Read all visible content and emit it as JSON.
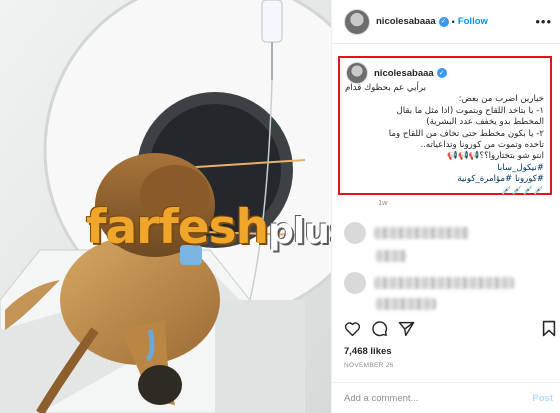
{
  "photo": {
    "description_icon": "lion-ct-scan-photo",
    "watermark": {
      "main": "farfesh",
      "sub": "plus.com"
    }
  },
  "post": {
    "username": "nicolesabaaa",
    "verified_icon": "verified-badge-icon",
    "separator": "•",
    "follow_label": "Follow",
    "more_icon": "more-options-icon",
    "caption_lines": [
      "برأيي عم بحظوك قدام",
      "خيارين اضرب من بعض:",
      "١- يا بتاخد اللقاح وبتموت (اذا مثل ما بقال",
      "المخطط بدو يخفف عدد البشرية)",
      "٢- يا بكون مخطط حتى تخاف من اللقاح وما",
      "تاخده وتموت من كورونا وتداعياته..",
      "انتو شو بتختاروا؟؟📢📢📢",
      "#نيكول_سابا",
      "#كورونا #مؤامرة_كونية",
      "💉💉💉💉"
    ],
    "caption_time": "1w",
    "like_count": "7,468 likes",
    "date": "NOVEMBER 26",
    "comment_placeholder": "Add a comment...",
    "post_label": "Post",
    "icons": {
      "like": "heart-icon",
      "comment": "comment-icon",
      "share": "share-icon",
      "save": "bookmark-icon"
    },
    "colors": {
      "accent": "#0095f6",
      "highlight_border": "#e0141b",
      "watermark_orange": "#f0a52b"
    }
  }
}
